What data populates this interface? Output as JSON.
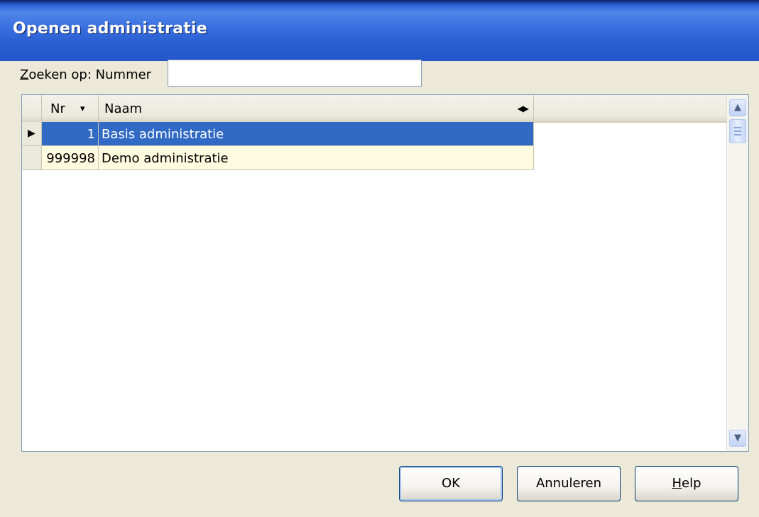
{
  "window": {
    "title": "Openen administratie"
  },
  "search": {
    "label_accel": "Z",
    "label_rest": "oeken op:",
    "field_name": "Nummer",
    "value": ""
  },
  "grid": {
    "columns": [
      {
        "label": "Nr"
      },
      {
        "label": "Naam"
      }
    ],
    "rows": [
      {
        "nr": "1",
        "naam": "Basis administratie",
        "selected": true
      },
      {
        "nr": "999998",
        "naam": "Demo administratie",
        "selected": false
      }
    ]
  },
  "buttons": {
    "ok": "OK",
    "cancel": "Annuleren",
    "help_accel": "H",
    "help_rest": "elp"
  },
  "icons": {
    "sort": "sort-desc-icon",
    "resize": "column-resize-icon",
    "row_pointer": "row-pointer-icon",
    "scroll_up": "chevron-up-icon",
    "scroll_down": "chevron-down-icon"
  },
  "colors": {
    "selection": "#316ac5",
    "row_alt": "#fffbe0",
    "titlebar": "#2a5fd2"
  }
}
